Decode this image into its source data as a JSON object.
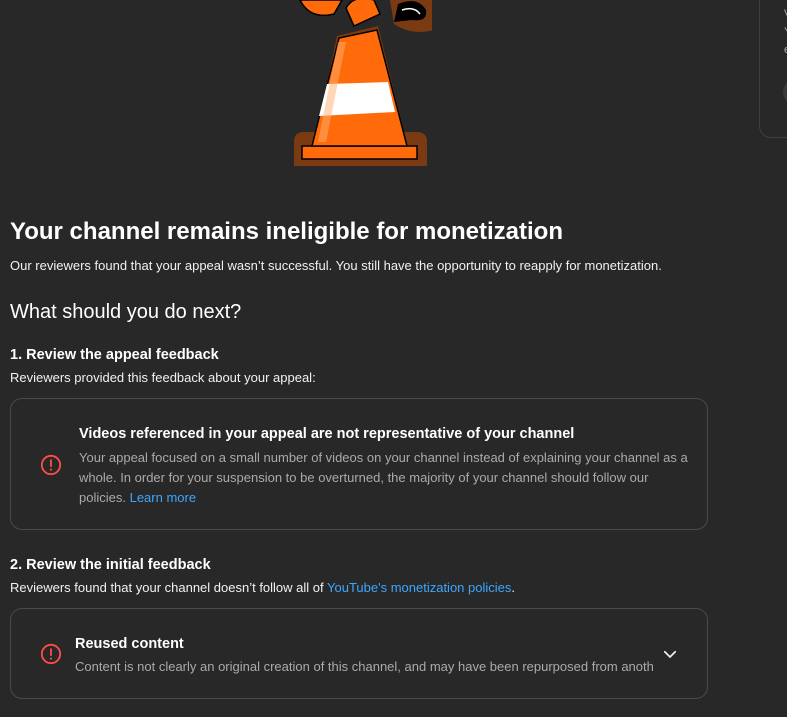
{
  "header": {
    "title": "Your channel remains ineligible for monetization",
    "subtitle": "Our reviewers found that your appeal wasn’t successful. You still have the opportunity to reapply for monetization."
  },
  "next_steps": {
    "heading": "What should you do next?",
    "step1": {
      "heading": "1. Review the appeal feedback",
      "description": "Reviewers provided this feedback about your appeal:",
      "card": {
        "icon": "alert-circle-icon",
        "title": "Videos referenced in your appeal are not representative of your channel",
        "body": "Your appeal focused on a small number of videos on your channel instead of explaining your channel as a whole. In order for your suspension to be overturned, the majority of your channel should follow our policies.",
        "link_label": "Learn more"
      }
    },
    "step2": {
      "heading": "2. Review the initial feedback",
      "description_prefix": "Reviewers found that your channel doesn’t follow all of",
      "link_label": "YouTube's monetization policies",
      "description_suffix": ".",
      "card": {
        "icon": "alert-circle-icon",
        "title": "Reused content",
        "body": "Content is not clearly an original creation of this channel, and may have been repurposed from anoth",
        "expand_icon": "chevron-down-icon"
      }
    }
  },
  "side_panel": {
    "fragments": [
      "V",
      "Y",
      "e"
    ]
  },
  "colors": {
    "background": "#282828",
    "link": "#3ea6ff",
    "alert": "#ff4e45",
    "cone_orange": "#ff6a0a"
  }
}
